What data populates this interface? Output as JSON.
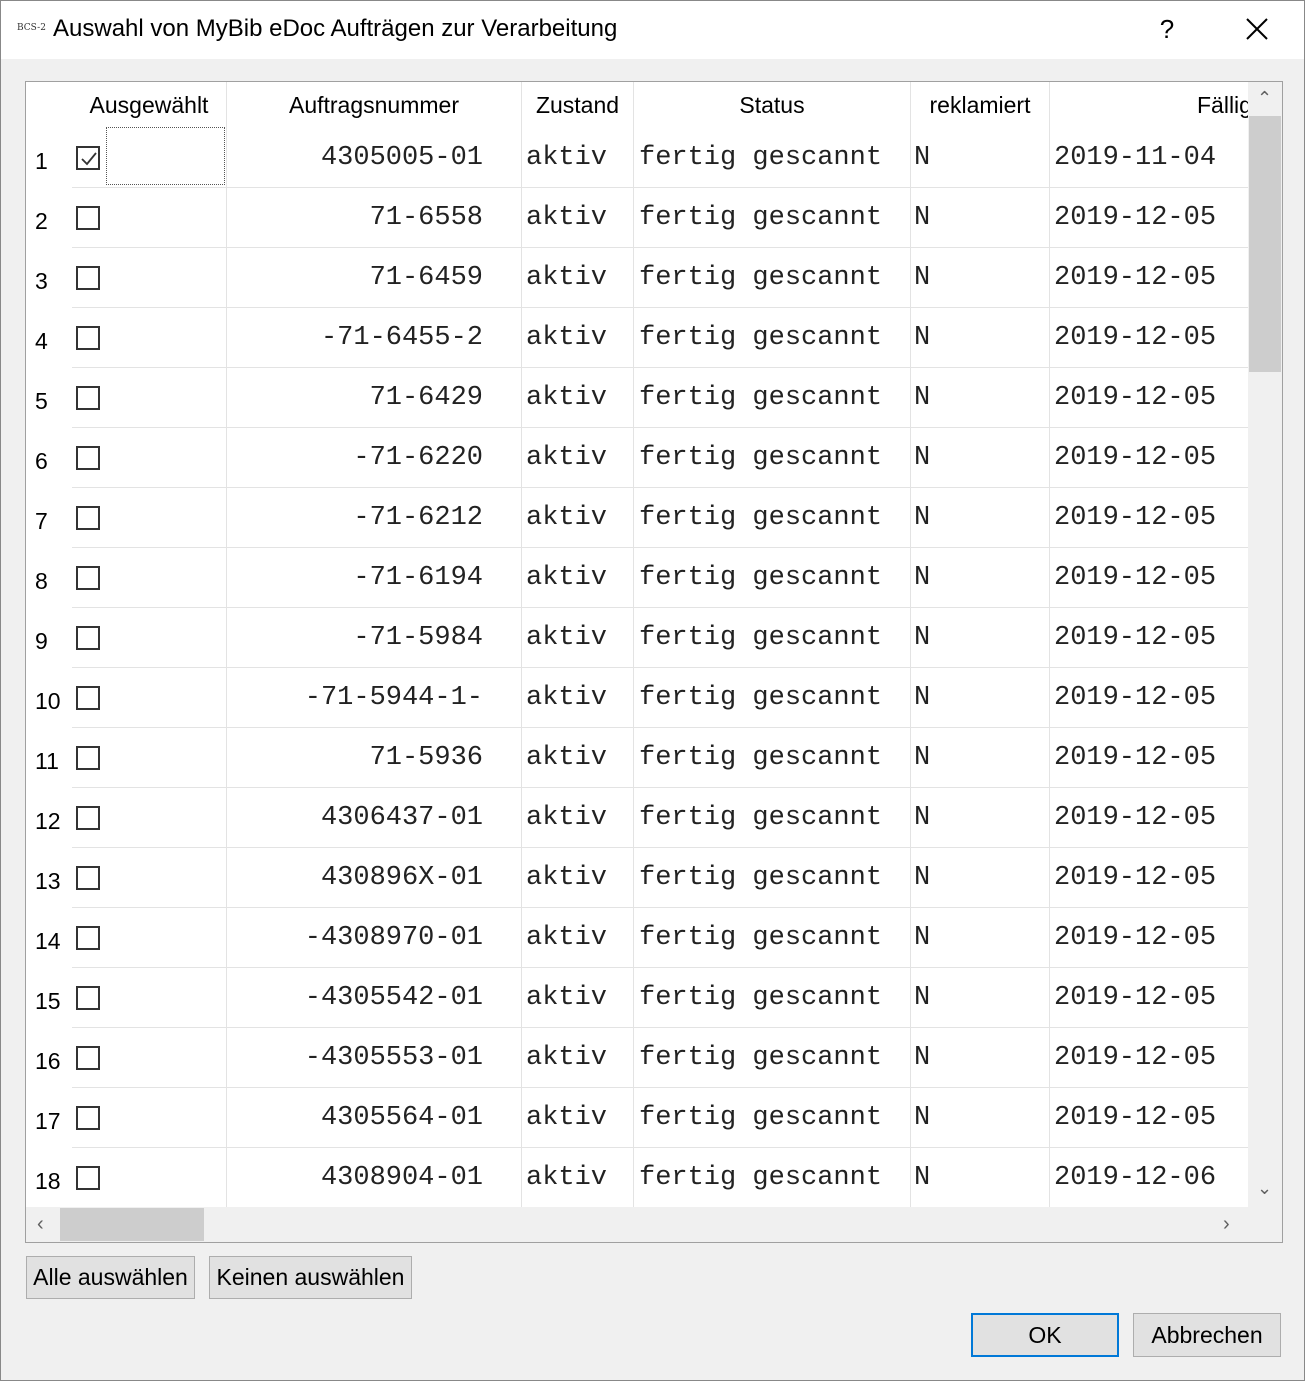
{
  "window": {
    "app_icon_text": "BCS-2",
    "title": "Auswahl von MyBib eDoc Aufträgen zur Verarbeitung",
    "help_label": "?"
  },
  "table": {
    "columns": {
      "selected": "Ausgewählt",
      "order_number": "Auftragsnummer",
      "state": "Zustand",
      "status": "Status",
      "claimed": "reklamiert",
      "due": "Fällig"
    },
    "rows": [
      {
        "n": "1",
        "checked": true,
        "order": "4305005-01",
        "state": "aktiv",
        "status": "fertig gescannt",
        "claimed": "N",
        "due": "2019-11-04"
      },
      {
        "n": "2",
        "checked": false,
        "order": "71-6558",
        "state": "aktiv",
        "status": "fertig gescannt",
        "claimed": "N",
        "due": "2019-12-05"
      },
      {
        "n": "3",
        "checked": false,
        "order": "71-6459",
        "state": "aktiv",
        "status": "fertig gescannt",
        "claimed": "N",
        "due": "2019-12-05"
      },
      {
        "n": "4",
        "checked": false,
        "order": "-71-6455-2",
        "state": "aktiv",
        "status": "fertig gescannt",
        "claimed": "N",
        "due": "2019-12-05"
      },
      {
        "n": "5",
        "checked": false,
        "order": "71-6429",
        "state": "aktiv",
        "status": "fertig gescannt",
        "claimed": "N",
        "due": "2019-12-05"
      },
      {
        "n": "6",
        "checked": false,
        "order": "-71-6220",
        "state": "aktiv",
        "status": "fertig gescannt",
        "claimed": "N",
        "due": "2019-12-05"
      },
      {
        "n": "7",
        "checked": false,
        "order": "-71-6212",
        "state": "aktiv",
        "status": "fertig gescannt",
        "claimed": "N",
        "due": "2019-12-05"
      },
      {
        "n": "8",
        "checked": false,
        "order": "-71-6194",
        "state": "aktiv",
        "status": "fertig gescannt",
        "claimed": "N",
        "due": "2019-12-05"
      },
      {
        "n": "9",
        "checked": false,
        "order": "-71-5984",
        "state": "aktiv",
        "status": "fertig gescannt",
        "claimed": "N",
        "due": "2019-12-05"
      },
      {
        "n": "10",
        "checked": false,
        "order": "-71-5944-1-",
        "state": "aktiv",
        "status": "fertig gescannt",
        "claimed": "N",
        "due": "2019-12-05"
      },
      {
        "n": "11",
        "checked": false,
        "order": "71-5936",
        "state": "aktiv",
        "status": "fertig gescannt",
        "claimed": "N",
        "due": "2019-12-05"
      },
      {
        "n": "12",
        "checked": false,
        "order": "4306437-01",
        "state": "aktiv",
        "status": "fertig gescannt",
        "claimed": "N",
        "due": "2019-12-05"
      },
      {
        "n": "13",
        "checked": false,
        "order": "430896X-01",
        "state": "aktiv",
        "status": "fertig gescannt",
        "claimed": "N",
        "due": "2019-12-05"
      },
      {
        "n": "14",
        "checked": false,
        "order": "-4308970-01",
        "state": "aktiv",
        "status": "fertig gescannt",
        "claimed": "N",
        "due": "2019-12-05"
      },
      {
        "n": "15",
        "checked": false,
        "order": "-4305542-01",
        "state": "aktiv",
        "status": "fertig gescannt",
        "claimed": "N",
        "due": "2019-12-05"
      },
      {
        "n": "16",
        "checked": false,
        "order": "-4305553-01",
        "state": "aktiv",
        "status": "fertig gescannt",
        "claimed": "N",
        "due": "2019-12-05"
      },
      {
        "n": "17",
        "checked": false,
        "order": "4305564-01",
        "state": "aktiv",
        "status": "fertig gescannt",
        "claimed": "N",
        "due": "2019-12-05"
      },
      {
        "n": "18",
        "checked": false,
        "order": "4308904-01",
        "state": "aktiv",
        "status": "fertig gescannt",
        "claimed": "N",
        "due": "2019-12-06"
      }
    ]
  },
  "buttons": {
    "select_all": "Alle auswählen",
    "select_none": "Keinen auswählen",
    "ok": "OK",
    "cancel": "Abbrechen"
  },
  "colors": {
    "default_button_border": "#0078d7",
    "scroll_thumb": "#cdcdcd"
  }
}
